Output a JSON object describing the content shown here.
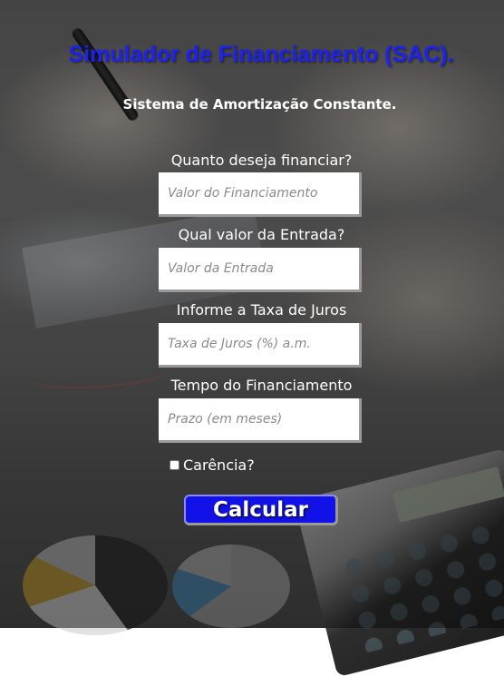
{
  "header": {
    "title": "Simulador de Financiamento (SAC).",
    "subtitle": "Sistema de Amortização Constante."
  },
  "form": {
    "fields": [
      {
        "label": "Quanto deseja financiar?",
        "placeholder": "Valor do Financiamento",
        "value": ""
      },
      {
        "label": "Qual valor da Entrada?",
        "placeholder": "Valor da Entrada",
        "value": ""
      },
      {
        "label": "Informe a Taxa de Juros",
        "placeholder": "Taxa de Juros (%) a.m.",
        "value": ""
      },
      {
        "label": "Tempo do Financiamento",
        "placeholder": "Prazo (em meses)",
        "value": ""
      }
    ],
    "checkbox": {
      "label": "Carência?",
      "checked": false
    },
    "submit_label": "Calcular"
  },
  "colors": {
    "title": "#1d22f0",
    "button_bg": "#1212e8",
    "text": "#ffffff"
  }
}
